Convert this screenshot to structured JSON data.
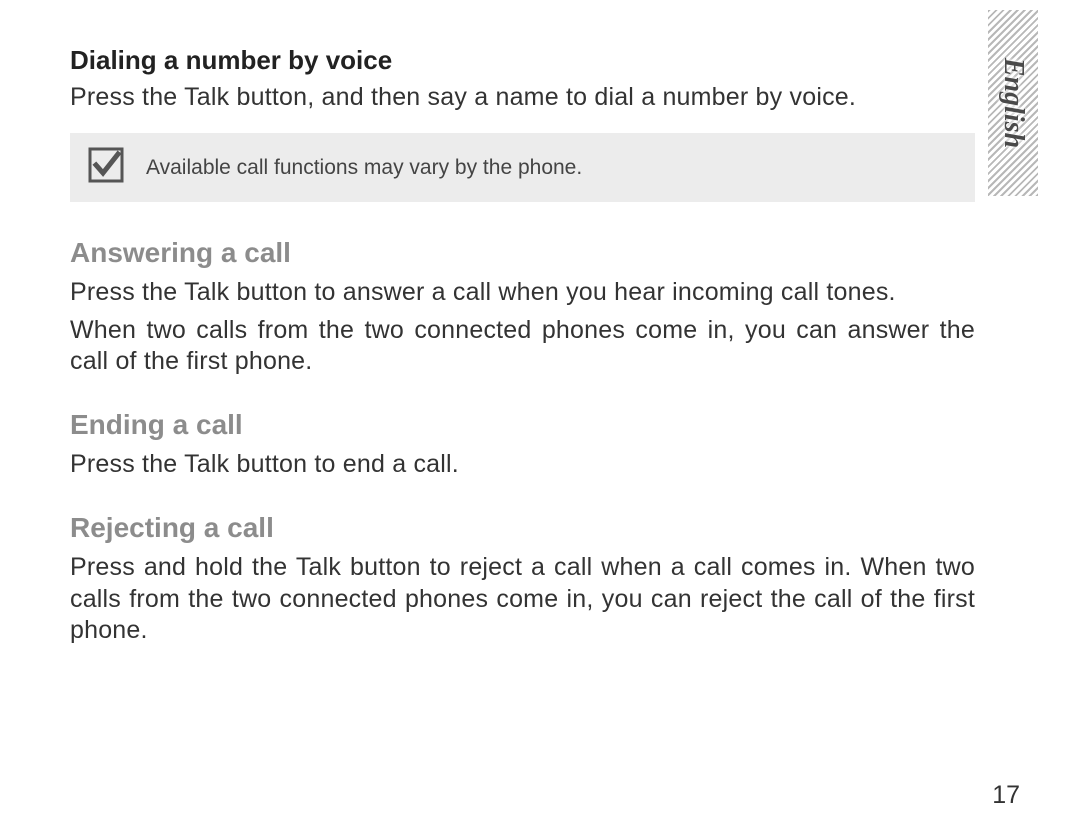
{
  "sideTab": {
    "label": "English"
  },
  "sections": {
    "dialing": {
      "heading": "Dialing a number by voice",
      "body": "Press the Talk button, and then say a name to dial a number by voice."
    },
    "note": {
      "icon": "checkmark-icon",
      "text": "Available call functions may vary by the phone."
    },
    "answering": {
      "heading": "Answering a call",
      "body1": "Press the Talk button to answer a call when you hear incoming call tones.",
      "body2": "When two calls from the two connected phones come in, you can answer the call of the first phone."
    },
    "ending": {
      "heading": "Ending a call",
      "body": "Press the Talk button to end a call."
    },
    "rejecting": {
      "heading": "Rejecting a call",
      "body": "Press and hold the Talk button to reject a call when a call comes in. When two calls from the two connected phones come in, you can reject the call of the first phone."
    }
  },
  "pageNumber": "17"
}
